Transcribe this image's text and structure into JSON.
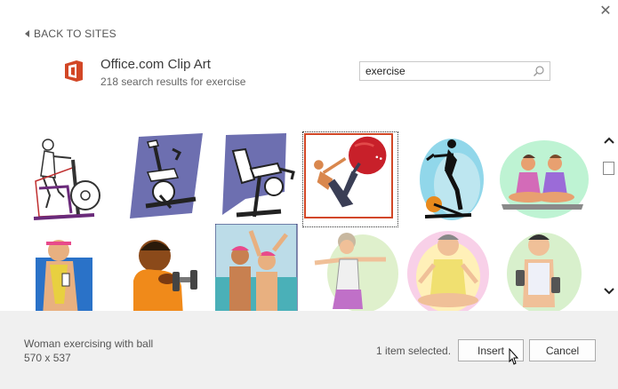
{
  "dialog": {
    "close_label": "✕"
  },
  "nav": {
    "back_label": "BACK TO SITES"
  },
  "site": {
    "title": "Office.com Clip Art",
    "subtitle": "218 search results for exercise",
    "brand_color": "#d24726"
  },
  "search": {
    "value": "exercise",
    "placeholder": ""
  },
  "footer": {
    "selected_name": "Woman exercising with ball",
    "selected_size": "570 x 537",
    "selection_count": "1 item selected.",
    "insert_label": "Insert",
    "cancel_label": "Cancel"
  },
  "icons": {
    "close": "close-icon",
    "back": "back-arrow-icon",
    "logo": "office-logo-icon",
    "search": "search-icon",
    "scroll_up": "chevron-up-icon",
    "scroll_down": "chevron-down-icon"
  }
}
